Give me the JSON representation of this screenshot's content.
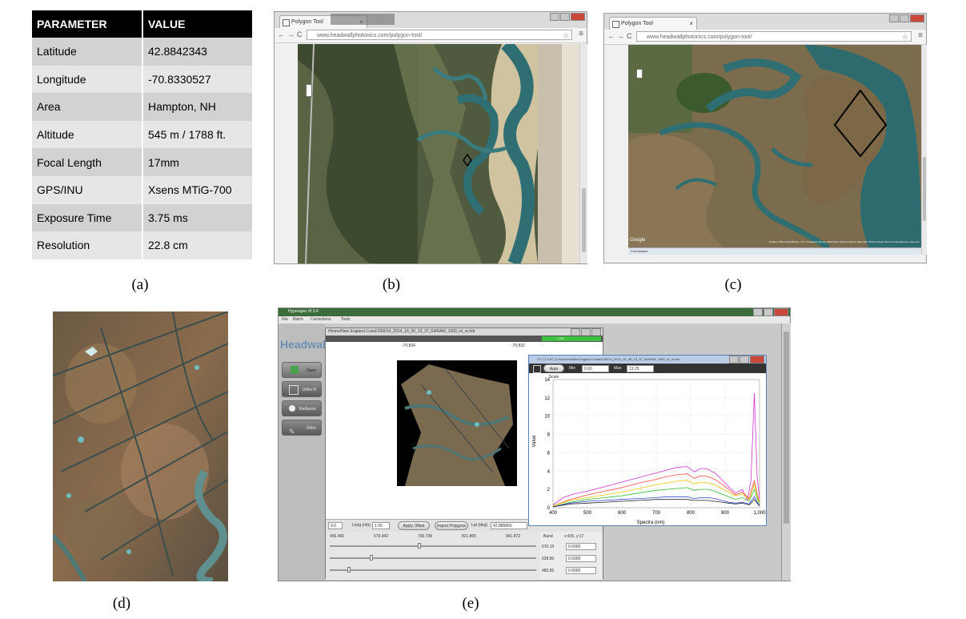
{
  "table": {
    "headers": [
      "PARAMETER",
      "VALUE"
    ],
    "rows": [
      [
        "Latitude",
        "42.8842343"
      ],
      [
        "Longitude",
        "-70.8330527"
      ],
      [
        "Area",
        "Hampton, NH"
      ],
      [
        "Altitude",
        "545 m / 1788 ft."
      ],
      [
        "Focal Length",
        "17mm"
      ],
      [
        "GPS/INU",
        "Xsens MTiG-700"
      ],
      [
        "Exposure Time",
        "3.75 ms"
      ],
      [
        "Resolution",
        "22.8 cm"
      ]
    ]
  },
  "captions": {
    "a": "(a)",
    "b": "(b)",
    "c": "(c)",
    "d": "(d)",
    "e": "(e)"
  },
  "browser_b": {
    "tab_title": "Polygon Tool",
    "url": "www.headwallphotonics.com/polygon-tool/"
  },
  "browser_c": {
    "tab_title": "Polygon Tool",
    "url": "www.headwallphotonics.com/polygon-tool/",
    "map_brand": "Google",
    "attribution": "Imagery ©2014 DigitalGlobe, U.S. Geological Survey, USDA Farm Service Agency, Map data ©2014 Google   Terms of Use   Report a map error",
    "panel_label": "Coordinates"
  },
  "software": {
    "title": "Hyperspec III 3.4",
    "menu": [
      "File",
      "Batch",
      "Corrections",
      "Tools"
    ],
    "logo": "Headwall",
    "side_buttons": [
      "Open",
      "Ortho R",
      "Radiance",
      "Ortho"
    ],
    "image_window": {
      "title": "/Home/New England Coast/100014_2014_10_30_13_37_54/RAW_1000_rd_or.hdr",
      "progress_label": "1.0%",
      "progress": 1.0,
      "top_ticks": [
        "-70.834",
        "-70.832"
      ],
      "controls": {
        "left_value": "0.0",
        "lpmb_label": "Long (mb)",
        "lpmb_value": "1.00",
        "apply_button": "Apply Offset",
        "import_button": "Import Polygons",
        "lat_label": "Lat (deg)",
        "lat_value": "42.885860"
      },
      "ruler_ticks": [
        "456.465",
        "579.942",
        "700.738",
        "821.805",
        "941.872"
      ],
      "bands": [
        {
          "wavelength": "670.19",
          "value": "0.0000"
        },
        {
          "wavelength": "538.80",
          "value": "0.0000"
        },
        {
          "wavelength": "480.85",
          "value": "0.0000"
        }
      ],
      "band_label": "Band",
      "coords": "x:435, y:17"
    },
    "spectral_window": {
      "title": "277 (7,4,97,1) Ho/Home/New England Coast/100014_2014_10_30_13_37_54/RAW_1000_rd_or.hdr",
      "autoscale_label": "Auto Scale",
      "min_label": "Min",
      "min_value": "0.00",
      "max_label": "Max",
      "max_value": "13.25"
    }
  },
  "chart_data": {
    "type": "line",
    "xlabel": "Spectra (nm)",
    "ylabel": "Value",
    "xlim": [
      400,
      1000
    ],
    "ylim": [
      0,
      14
    ],
    "xticks": [
      "400",
      "500",
      "600",
      "700",
      "800",
      "900",
      "1,000"
    ],
    "yticks": [
      "0",
      "2",
      "4",
      "6",
      "8",
      "10",
      "12",
      "14"
    ],
    "grid": true,
    "series": [
      {
        "color": "#cc33cc",
        "x": [
          400,
          430,
          460,
          500,
          550,
          600,
          650,
          700,
          730,
          760,
          790,
          810,
          830,
          850,
          870,
          890,
          910,
          930,
          950,
          965,
          975,
          985,
          993,
          1000
        ],
        "values": [
          0.3,
          1.1,
          1.5,
          1.8,
          2.3,
          2.8,
          3.3,
          3.8,
          4.1,
          4.4,
          4.5,
          3.9,
          4.3,
          4.2,
          3.8,
          3.1,
          2.3,
          1.6,
          2.0,
          0.8,
          3.0,
          12.5,
          3.5,
          1.0
        ]
      },
      {
        "color": "#ff4444",
        "x": [
          400,
          450,
          500,
          550,
          600,
          650,
          700,
          730,
          760,
          790,
          810,
          830,
          850,
          870,
          890,
          910,
          930,
          950,
          970,
          985,
          995,
          1000
        ],
        "values": [
          0.2,
          0.9,
          1.4,
          1.8,
          2.2,
          2.7,
          3.1,
          3.4,
          3.6,
          3.7,
          3.2,
          3.5,
          3.4,
          3.1,
          2.6,
          2.0,
          1.4,
          1.7,
          1.0,
          3.0,
          1.2,
          0.7
        ]
      },
      {
        "color": "#e6c800",
        "x": [
          400,
          450,
          500,
          550,
          600,
          650,
          700,
          730,
          760,
          790,
          810,
          830,
          850,
          870,
          890,
          910,
          930,
          950,
          970,
          985,
          995,
          1000
        ],
        "values": [
          0.2,
          0.8,
          1.1,
          1.4,
          1.7,
          2.1,
          2.5,
          2.7,
          2.9,
          3.0,
          2.6,
          2.8,
          2.7,
          2.5,
          2.1,
          1.7,
          1.3,
          1.5,
          0.9,
          2.6,
          1.0,
          0.6
        ]
      },
      {
        "color": "#33bb33",
        "x": [
          400,
          450,
          500,
          550,
          600,
          650,
          700,
          730,
          760,
          790,
          810,
          830,
          850,
          870,
          890,
          910,
          930,
          950,
          970,
          985,
          995,
          1000
        ],
        "values": [
          0.1,
          0.6,
          0.9,
          1.1,
          1.3,
          1.6,
          1.9,
          2.0,
          2.1,
          2.2,
          1.9,
          2.0,
          2.0,
          1.8,
          1.5,
          1.2,
          0.9,
          1.1,
          0.7,
          2.0,
          0.8,
          0.5
        ]
      },
      {
        "color": "#3344cc",
        "x": [
          400,
          450,
          500,
          550,
          600,
          650,
          700,
          730,
          760,
          790,
          810,
          830,
          850,
          870,
          890,
          910,
          930,
          950,
          970,
          985,
          995,
          1000
        ],
        "values": [
          0.1,
          0.5,
          0.7,
          0.8,
          0.9,
          1.0,
          1.1,
          1.2,
          1.2,
          1.2,
          1.0,
          1.1,
          1.1,
          1.0,
          0.8,
          0.6,
          0.5,
          0.6,
          0.4,
          1.2,
          0.5,
          0.3
        ]
      },
      {
        "color": "#222222",
        "x": [
          400,
          450,
          500,
          550,
          600,
          650,
          700,
          730,
          760,
          790,
          810,
          830,
          850,
          870,
          890,
          910,
          930,
          950,
          970,
          985,
          995,
          1000
        ],
        "values": [
          0.1,
          0.4,
          0.5,
          0.6,
          0.7,
          0.8,
          0.9,
          0.9,
          0.9,
          0.9,
          0.8,
          0.8,
          0.8,
          0.7,
          0.6,
          0.5,
          0.4,
          0.5,
          0.3,
          0.9,
          0.4,
          0.2
        ]
      }
    ]
  }
}
